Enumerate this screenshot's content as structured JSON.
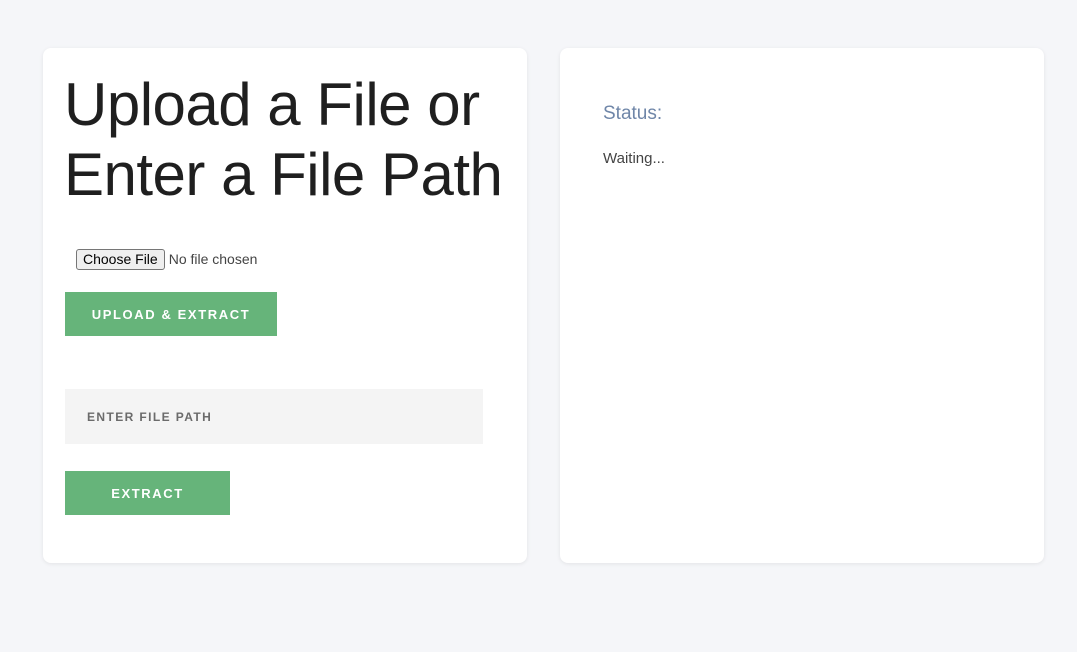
{
  "upload_panel": {
    "heading": "Upload a File or Enter a File Path",
    "file_input": {
      "button_label": "Choose File",
      "status": "No file chosen"
    },
    "upload_button_label": "UPLOAD & EXTRACT",
    "path_input": {
      "value": "",
      "placeholder": "ENTER FILE PATH"
    },
    "extract_button_label": "EXTRACT"
  },
  "status_panel": {
    "label": "Status:",
    "text": "Waiting..."
  },
  "colors": {
    "background": "#f5f6f9",
    "accent_green": "#66b47a",
    "status_label": "#6f86a8"
  }
}
